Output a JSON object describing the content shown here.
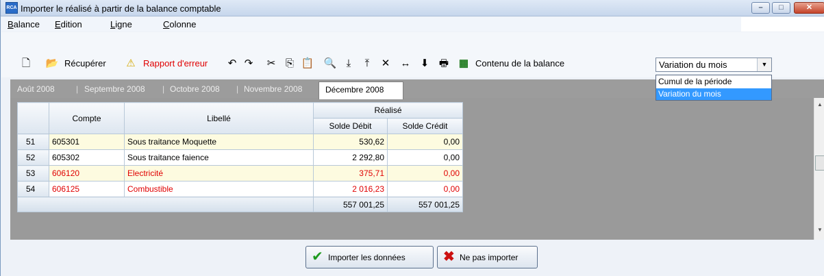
{
  "window": {
    "title": "Importer le réalisé à partir de la balance comptable",
    "app_icon_text": "RCA",
    "controls": {
      "minimize": "–",
      "maximize": "□",
      "close": "✕"
    }
  },
  "menu": [
    "Balance",
    "Edition",
    "Ligne",
    "Colonne"
  ],
  "toolbar": {
    "recuperer": "Récupérer",
    "rapport_erreur": "Rapport d'erreur",
    "contenu_label": "Contenu de la balance",
    "contenu_value": "Variation du mois",
    "contenu_options": [
      "Cumul de la période",
      "Variation du mois"
    ]
  },
  "tabs": [
    "Août 2008",
    "Septembre 2008",
    "Octobre 2008",
    "Novembre 2008"
  ],
  "active_tab": "Décembre 2008",
  "grid": {
    "headers": {
      "compte": "Compte",
      "libelle": "Libellé",
      "realise": "Réalisé",
      "solde_debit": "Solde Débit",
      "solde_credit": "Solde Crédit"
    },
    "rows": [
      {
        "idx": "51",
        "compte": "605301",
        "libelle": "Sous traitance Moquette",
        "debit": "530,62",
        "credit": "0,00"
      },
      {
        "idx": "52",
        "compte": "605302",
        "libelle": "Sous traitance faience",
        "debit": "2 292,80",
        "credit": "0,00"
      },
      {
        "idx": "53",
        "compte": "606120",
        "libelle": "Electricité",
        "debit": "375,71",
        "credit": "0,00"
      },
      {
        "idx": "54",
        "compte": "606125",
        "libelle": "Combustible",
        "debit": "2 016,23",
        "credit": "0,00"
      }
    ],
    "totals": {
      "debit": "557 001,25",
      "credit": "557 001,25"
    }
  },
  "buttons": {
    "importer": "Importer les données",
    "ne_pas_importer": "Ne pas importer"
  },
  "colors": {
    "error_text": "#e00000",
    "selected_option": "#3399ff",
    "ok_check": "#1e9a1e",
    "cancel_x": "#cc1111"
  }
}
